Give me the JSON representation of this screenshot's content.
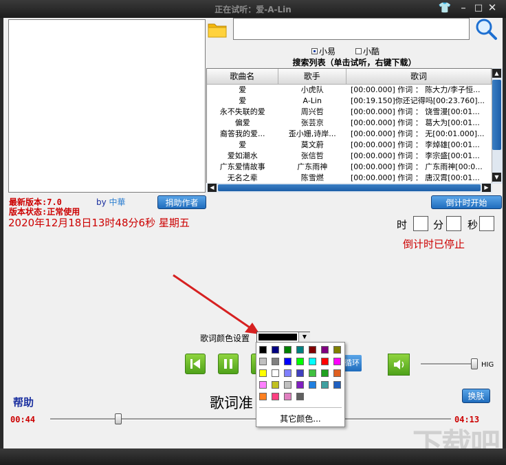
{
  "window": {
    "title": "正在试听：爱-A-Lin",
    "controls": {
      "skin": "👕",
      "minimize": "–",
      "maximize": "□",
      "close": "✕"
    }
  },
  "search": {
    "value": "",
    "placeholder": ""
  },
  "sources": [
    {
      "label": "小易",
      "selected": true
    },
    {
      "label": "小酷",
      "selected": false
    }
  ],
  "search_list_label": "搜索列表（单击试听，右键下载）",
  "table": {
    "headers": [
      "歌曲名",
      "歌手",
      "歌词"
    ],
    "rows": [
      [
        "爱",
        "小虎队",
        "[00:00.000] 作词 ： 陈大力/李子恒..."
      ],
      [
        "爱",
        "A-Lin",
        "[00:19.150]你还记得吗[00:23.760]..."
      ],
      [
        "永不失联的爱",
        "周兴哲",
        "[00:00.000] 作词 ： 饶雪漫[00:01..."
      ],
      [
        "偏爱",
        "张芸京",
        "[00:00.000] 作词 ： 葛大为[00:01..."
      ],
      [
        "裔答我的爱...",
        "歪小姗,诗岸...",
        "[00:00.000] 作词 ： 无[00:01.000]..."
      ],
      [
        "爱",
        "莫文蔚",
        "[00:00.000] 作词 ： 李焯雄[00:01..."
      ],
      [
        "爱如潮水",
        "张信哲",
        "[00:00.000] 作词 ： 李宗盛[00:01..."
      ],
      [
        "广东爱情故事",
        "广东雨神",
        "[00:00.000] 作词 ： 广东雨神[00:0..."
      ],
      [
        "无名之辈",
        "陈雪燃",
        "[00:00.000] 作词 ： 唐汉霄[00:01..."
      ]
    ]
  },
  "info": {
    "version": "最新版本:7.0",
    "by": "by",
    "author": "中華",
    "status": "版本状态:正常使用",
    "datetime": "2020年12月18日13时48分6秒  星期五"
  },
  "buttons": {
    "donate": "捐助作者",
    "countdown_start": "倒计时开始",
    "loop": "循环",
    "skin": "换肤",
    "other_color": "其它颜色..."
  },
  "countdown": {
    "hour_unit": "时",
    "minute_unit": "分",
    "second_unit": "秒",
    "status": "倒计时已停止"
  },
  "lyric_color": {
    "label": "歌词颜色设置",
    "current": "#000000"
  },
  "palette": [
    [
      "#000000",
      "#000080",
      "#008000",
      "#008080",
      "#800000",
      "#800080",
      "#808000"
    ],
    [
      "#c0c0c0",
      "#808080",
      "#0000ff",
      "#00ff00",
      "#00ffff",
      "#ff0000",
      "#ff00ff"
    ],
    [
      "#ffff00",
      "#ffffff",
      "#8080ff",
      "#4040c0",
      "#40c040",
      "#20a020",
      "#e06020"
    ],
    [
      "#ff80ff",
      "#c0c020",
      "#c0c0c0",
      "#8020c0",
      "#2080e0",
      "#40a0a0",
      "#2060c0"
    ],
    [
      "#ff8020",
      "#ff4080",
      "#e080c0",
      "#606060"
    ]
  ],
  "volume": {
    "label": "HIG",
    "level": 0.95
  },
  "progress": {
    "position": 0.17
  },
  "help": "帮助",
  "lyric_display": "歌词准",
  "time": {
    "current": "00:44",
    "total": "04:13"
  },
  "watermark": "下载吧"
}
